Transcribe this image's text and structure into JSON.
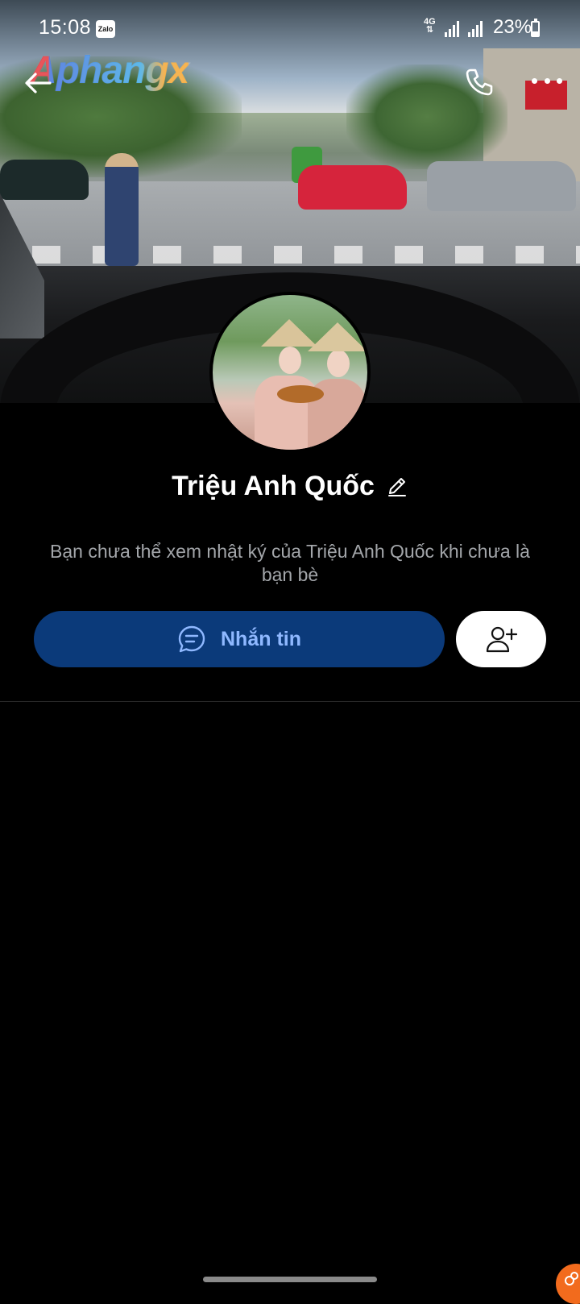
{
  "status_bar": {
    "time": "15:08",
    "app_badge": "Zalo",
    "network": "4G",
    "battery_percent": "23%",
    "battery_level": 0.23
  },
  "cover": {
    "watermark": "Aphangx"
  },
  "profile": {
    "name": "Triệu Anh Quốc",
    "notice": "Bạn chưa thể xem nhật ký của Triệu Anh Quốc khi chưa là bạn bè"
  },
  "actions": {
    "message_label": "Nhắn tin"
  },
  "icons": {
    "back": "back-arrow-icon",
    "call": "phone-icon",
    "more": "more-dots-icon",
    "edit": "pencil-icon",
    "chat": "chat-bubble-icon",
    "add_friend": "add-user-icon"
  },
  "colors": {
    "background": "#000000",
    "message_button": "#0b3a7a",
    "message_label": "#8fb8ff",
    "notice_text": "#a3a6aa"
  }
}
